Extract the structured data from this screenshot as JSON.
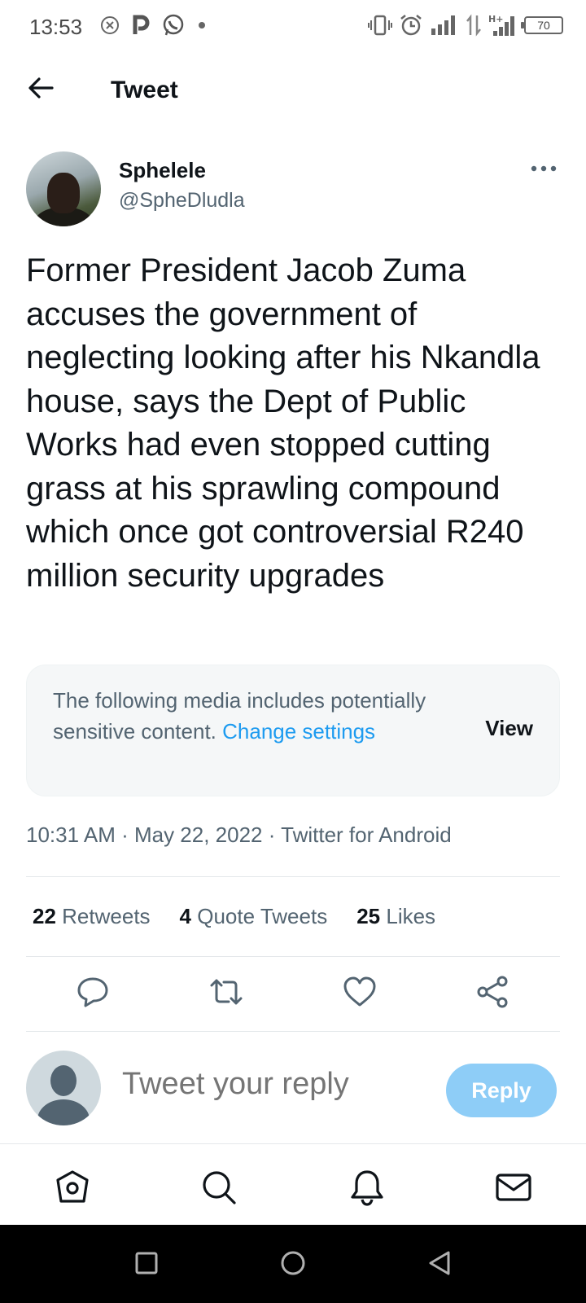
{
  "status_bar": {
    "time": "13:53",
    "battery": "70"
  },
  "header": {
    "title": "Tweet"
  },
  "tweet": {
    "display_name": "Sphelele",
    "handle": "@SpheDludla",
    "text": "Former President Jacob Zuma accuses the government of neglecting looking after his Nkandla house, says the Dept of Public Works had even stopped cutting grass at his sprawling compound which once got controversial R240 million security upgrades",
    "sensitive_notice": "The following media includes potentially sensitive content.",
    "change_settings_label": "Change settings",
    "view_label": "View",
    "meta": "10:31 AM · May 22, 2022 · Twitter for Android",
    "stats": {
      "retweets_count": "22",
      "retweets_label": "Retweets",
      "quotes_count": "4",
      "quotes_label": "Quote Tweets",
      "likes_count": "25",
      "likes_label": "Likes"
    }
  },
  "reply": {
    "placeholder": "Tweet your reply",
    "button_label": "Reply"
  },
  "colors": {
    "accent": "#1d9bf0",
    "reply_button": "#8ecdf7",
    "secondary_text": "#536471"
  },
  "icons": {
    "status_left": [
      "close-circle-icon",
      "p-app-icon",
      "whatsapp-icon",
      "dot-icon"
    ],
    "status_right": [
      "vibrate-icon",
      "alarm-icon",
      "signal-icon",
      "data-arrows-icon",
      "hplus-signal-icon",
      "battery-icon"
    ],
    "actions": [
      "reply-icon",
      "retweet-icon",
      "like-icon",
      "share-icon"
    ],
    "bottom_nav": [
      "home-icon",
      "search-icon",
      "notifications-icon",
      "messages-icon"
    ],
    "system_nav": [
      "recents-icon",
      "home-circle-icon",
      "back-triangle-icon"
    ]
  }
}
